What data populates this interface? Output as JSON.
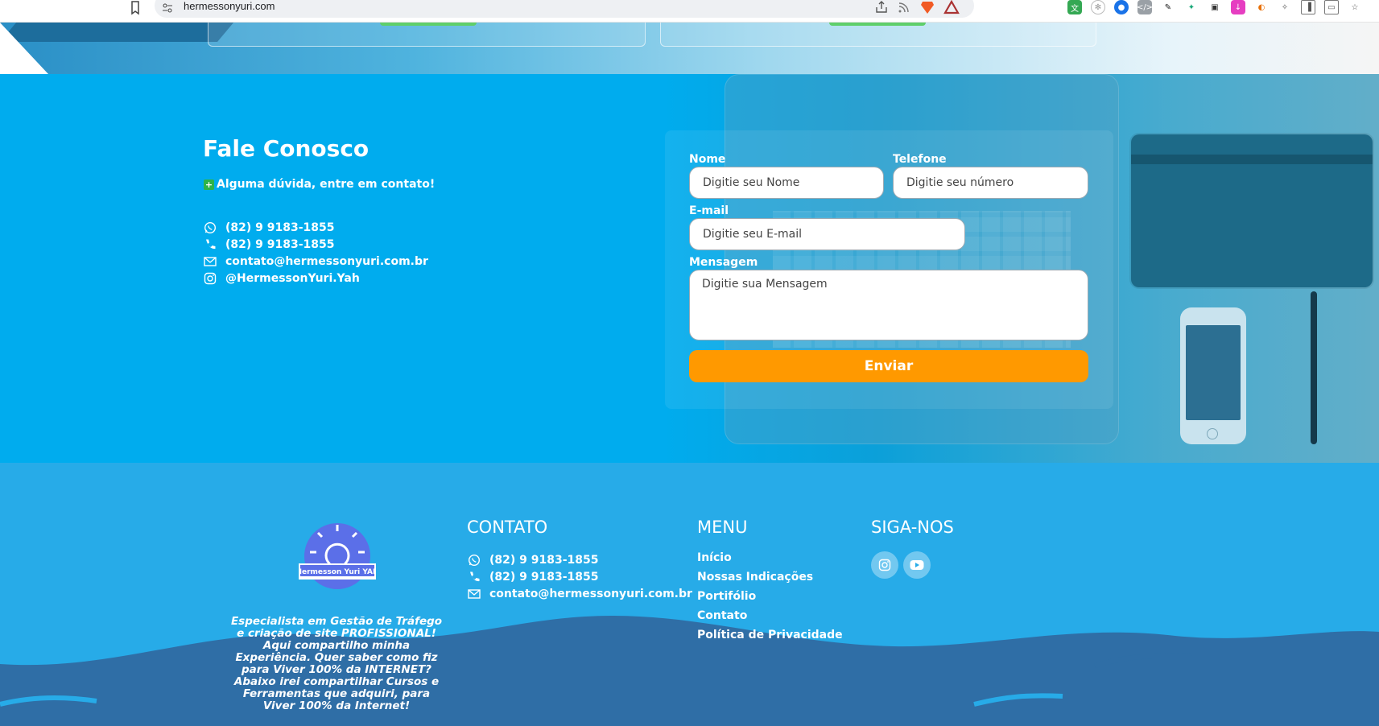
{
  "browser": {
    "url": "hermessonyuri.com",
    "extensions": [
      "translate-icon",
      "openai-icon",
      "blue-circle-icon",
      "code-icon",
      "eyedropper-icon",
      "green-pin-icon",
      "printer-icon",
      "download-icon",
      "color-icon",
      "puzzle-icon",
      "sidebar-icon",
      "wallet-icon",
      "star-icon"
    ]
  },
  "contact": {
    "title": "Fale Conosco",
    "subtitle": "Alguma dúvida, entre em contato!",
    "items": [
      {
        "icon": "whatsapp-icon",
        "text": "(82) 9 9183-1855"
      },
      {
        "icon": "phone-icon",
        "text": "(82) 9 9183-1855"
      },
      {
        "icon": "mail-icon",
        "text": "contato@hermessonyuri.com.br"
      },
      {
        "icon": "instagram-icon",
        "text": "@HermessonYuri.Yah"
      }
    ]
  },
  "form": {
    "name_label": "Nome",
    "name_placeholder": "Digitie seu Nome",
    "phone_label": "Telefone",
    "phone_placeholder": "Digitie seu número",
    "email_label": "E-mail",
    "email_placeholder": "Digitie seu E-mail",
    "message_label": "Mensagem",
    "message_placeholder": "Digitie sua Mensagem",
    "submit_label": "Enviar"
  },
  "footer": {
    "logo_text": "Hermesson Yuri YAH",
    "about": "Especialista em Gestão de Tráfego e criação de site PROFISSIONAL! Aqui compartilho minha Experiência. Quer saber como fiz para Viver 100% da INTERNET? Abaixo irei compartilhar Cursos e Ferramentas que adquiri, para Viver 100% da Internet!",
    "contato_title": "CONTATO",
    "contato_items": [
      {
        "icon": "whatsapp-icon",
        "text": "(82) 9 9183-1855"
      },
      {
        "icon": "phone-icon",
        "text": "(82) 9 9183-1855"
      },
      {
        "icon": "mail-icon",
        "text": "contato@hermessonyuri.com.br"
      }
    ],
    "menu_title": "MENU",
    "menu_items": [
      "Início",
      "Nossas Indicações",
      "Portifólio",
      "Contato",
      "Política de Privacidade"
    ],
    "social_title": "SIGA-NOS"
  },
  "colors": {
    "contact_bg": "#00acee",
    "footer_bg": "#27abe8",
    "button": "#ff9900",
    "wave": "#2f6ea6"
  }
}
